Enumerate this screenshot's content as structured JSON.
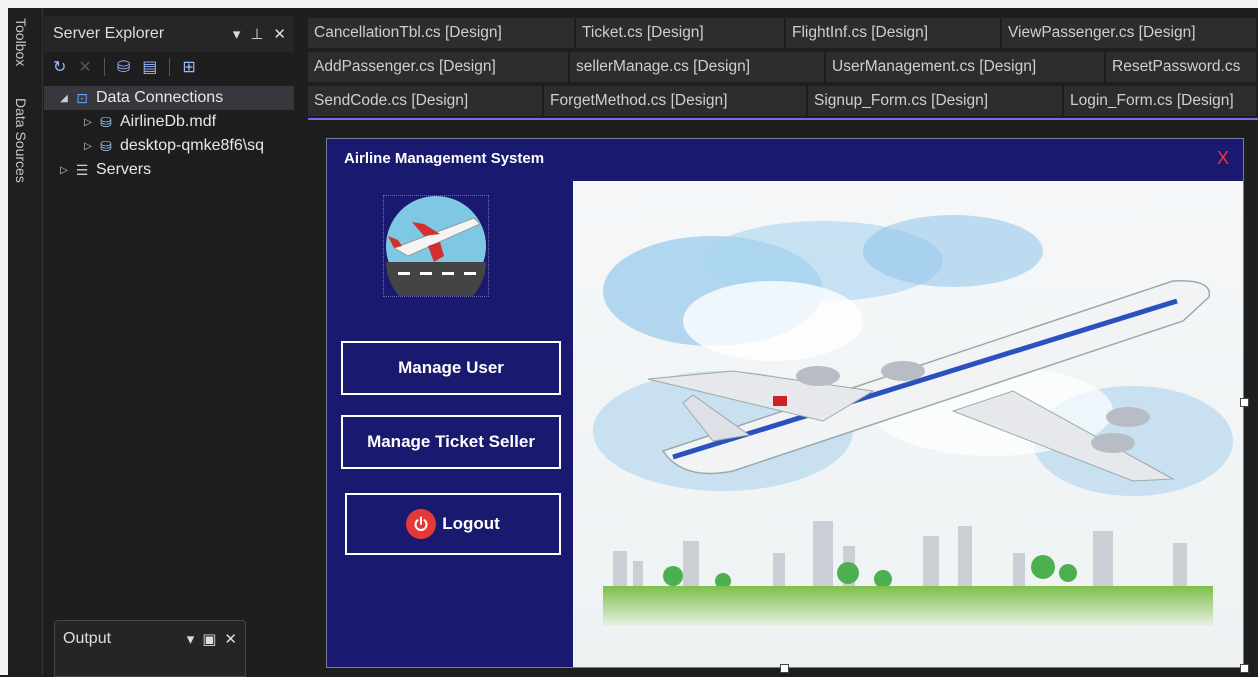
{
  "rail": {
    "toolbox_label": "Toolbox",
    "data_sources_label": "Data Sources"
  },
  "server_explorer": {
    "title": "Server Explorer",
    "tree": [
      {
        "label": "Data Connections",
        "arrow": "◢",
        "icon": "data-connections-icon"
      },
      {
        "label": "AirlineDb.mdf",
        "arrow": "▷",
        "icon": "database-icon"
      },
      {
        "label": "desktop-qmke8f6\\sq",
        "arrow": "▷",
        "icon": "database-icon"
      },
      {
        "label": "Servers",
        "arrow": "▷",
        "icon": "servers-icon"
      }
    ]
  },
  "output_panel": {
    "title": "Output"
  },
  "tabs": [
    [
      "CancellationTbl.cs [Design]",
      "Ticket.cs [Design]",
      "FlightInf.cs [Design]",
      "ViewPassenger.cs [Design]"
    ],
    [
      "AddPassenger.cs [Design]",
      "sellerManage.cs [Design]",
      "UserManagement.cs [Design]",
      "ResetPassword.cs"
    ],
    [
      "SendCode.cs [Design]",
      "ForgetMethod.cs [Design]",
      "Signup_Form.cs [Design]",
      "Login_Form.cs [Design]"
    ]
  ],
  "form": {
    "title": "Airline Management System",
    "close_label": "X",
    "buttons": {
      "manage_user": "Manage User",
      "manage_ticket_seller": "Manage Ticket Seller",
      "logout": "Logout"
    }
  },
  "colors": {
    "form_bg": "#191970",
    "tab_accent": "#7b68ee",
    "close_red": "#ff3030",
    "logout_red": "#e53935"
  }
}
